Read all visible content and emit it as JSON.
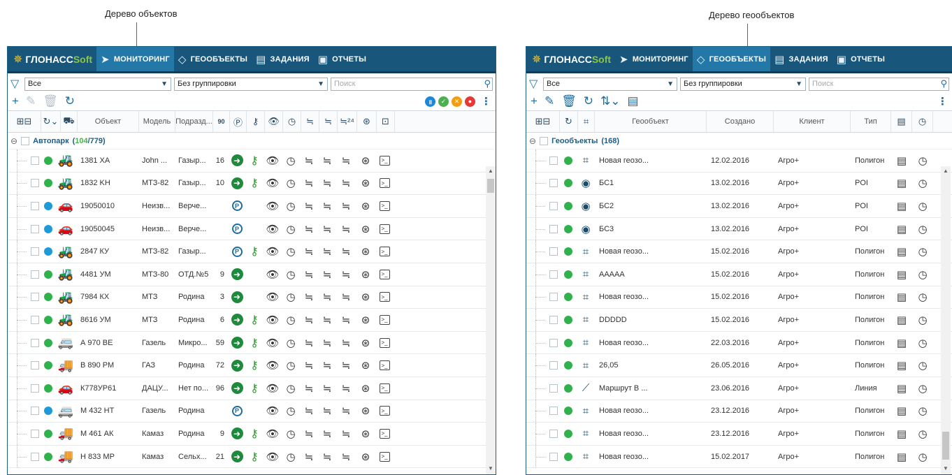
{
  "callouts": {
    "left": "Дерево объектов",
    "right": "Дерево геообъектов"
  },
  "brand": {
    "part1": "ГЛОНАСС",
    "part2": "Soft"
  },
  "nav": [
    {
      "label": "МОНИТОРИНГ",
      "icon": "navigation-arrow-icon"
    },
    {
      "label": "ГЕООБЪЕКТЫ",
      "icon": "geoobject-diamond-icon"
    },
    {
      "label": "ЗАДАНИЯ",
      "icon": "tasks-icon"
    },
    {
      "label": "ОТЧЕТЫ",
      "icon": "reports-icon"
    }
  ],
  "left_panel": {
    "filter_value": "Все",
    "grouping_value": "Без группировки",
    "search_placeholder": "Поиск",
    "columns": [
      "Объект",
      "Модель",
      "Подразд..."
    ],
    "speed_header": "90",
    "group": {
      "name": "Автопарк",
      "online": "104",
      "total": "779"
    },
    "rows": [
      {
        "name": "1381 XA",
        "model": "John ...",
        "dept": "Газыр...",
        "speed": "16",
        "status": "green",
        "vehicle": "tractor",
        "go": true,
        "park": false,
        "key": true
      },
      {
        "name": "1832 KH",
        "model": "МТЗ-82",
        "dept": "Газыр...",
        "speed": "10",
        "status": "green",
        "vehicle": "loader",
        "go": true,
        "park": false,
        "key": true
      },
      {
        "name": "19050010",
        "model": "Неизв...",
        "dept": "Верче...",
        "speed": "",
        "status": "blue",
        "vehicle": "car",
        "go": false,
        "park": true,
        "key": false
      },
      {
        "name": "19050045",
        "model": "Неизв...",
        "dept": "Верче...",
        "speed": "",
        "status": "blue",
        "vehicle": "car",
        "go": false,
        "park": true,
        "key": false
      },
      {
        "name": "2847 КУ",
        "model": "МТЗ-82",
        "dept": "Газыр...",
        "speed": "",
        "status": "blue",
        "vehicle": "loader",
        "go": false,
        "park": true,
        "key": true
      },
      {
        "name": "4481 УМ",
        "model": "МТЗ-80",
        "dept": "ОТД.№5",
        "speed": "9",
        "status": "green",
        "vehicle": "loader",
        "go": true,
        "park": false,
        "key": false
      },
      {
        "name": "7984 КХ",
        "model": "МТЗ",
        "dept": "Родина",
        "speed": "3",
        "status": "green",
        "vehicle": "loader",
        "go": true,
        "park": false,
        "key": false
      },
      {
        "name": "8616 УМ",
        "model": "МТЗ",
        "dept": "Родина",
        "speed": "6",
        "status": "green",
        "vehicle": "loader",
        "go": true,
        "park": false,
        "key": true
      },
      {
        "name": "А 970 ВЕ",
        "model": "Газель",
        "dept": "Микро...",
        "speed": "59",
        "status": "green",
        "vehicle": "van",
        "go": true,
        "park": false,
        "key": true
      },
      {
        "name": "В 890 РМ",
        "model": "ГАЗ",
        "dept": "Родина",
        "speed": "72",
        "status": "green",
        "vehicle": "truck",
        "go": true,
        "park": false,
        "key": true
      },
      {
        "name": "К778УР61",
        "model": "ДАЦУ...",
        "dept": "Нет по...",
        "speed": "96",
        "status": "green",
        "vehicle": "car",
        "go": true,
        "park": false,
        "key": true
      },
      {
        "name": "М 432 НТ",
        "model": "Газель",
        "dept": "Родина",
        "speed": "",
        "status": "blue",
        "vehicle": "van",
        "go": false,
        "park": true,
        "key": false
      },
      {
        "name": "М 461 АК",
        "model": "Камаз",
        "dept": "Родина",
        "speed": "9",
        "status": "green",
        "vehicle": "truck",
        "go": true,
        "park": false,
        "key": true
      },
      {
        "name": "Н 833 МР",
        "model": "Камаз",
        "dept": "Сельх...",
        "speed": "21",
        "status": "green",
        "vehicle": "truck",
        "go": true,
        "park": false,
        "key": true
      }
    ]
  },
  "right_panel": {
    "filter_value": "Все",
    "grouping_value": "Без группировки",
    "search_placeholder": "Поиск",
    "columns": [
      "Геообъект",
      "Создано",
      "Клиент",
      "Тип"
    ],
    "group": {
      "name": "Геообъекты",
      "count": "168"
    },
    "rows": [
      {
        "name": "Новая геозо...",
        "created": "12.02.2016",
        "client": "Агро+",
        "type": "Полигон",
        "kind": "polygon"
      },
      {
        "name": "БС1",
        "created": "13.02.2016",
        "client": "Агро+",
        "type": "POI",
        "kind": "poi"
      },
      {
        "name": "БС2",
        "created": "13.02.2016",
        "client": "Агро+",
        "type": "POI",
        "kind": "poi"
      },
      {
        "name": "БС3",
        "created": "13.02.2016",
        "client": "Агро+",
        "type": "POI",
        "kind": "poi"
      },
      {
        "name": "Новая геозо...",
        "created": "15.02.2016",
        "client": "Агро+",
        "type": "Полигон",
        "kind": "polygon"
      },
      {
        "name": "ААААА",
        "created": "15.02.2016",
        "client": "Агро+",
        "type": "Полигон",
        "kind": "polygon"
      },
      {
        "name": "Новая геозо...",
        "created": "15.02.2016",
        "client": "Агро+",
        "type": "Полигон",
        "kind": "polygon"
      },
      {
        "name": "DDDDD",
        "created": "15.02.2016",
        "client": "Агро+",
        "type": "Полигон",
        "kind": "polygon"
      },
      {
        "name": "Новая геозо...",
        "created": "22.03.2016",
        "client": "Агро+",
        "type": "Полигон",
        "kind": "polygon"
      },
      {
        "name": "26,05",
        "created": "26.05.2016",
        "client": "Агро+",
        "type": "Полигон",
        "kind": "polygon"
      },
      {
        "name": "Маршрут В ...",
        "created": "23.06.2016",
        "client": "Агро+",
        "type": "Линия",
        "kind": "line"
      },
      {
        "name": "Новая геозо...",
        "created": "23.12.2016",
        "client": "Агро+",
        "type": "Полигон",
        "kind": "polygon"
      },
      {
        "name": "Новая геозо...",
        "created": "23.12.2016",
        "client": "Агро+",
        "type": "Полигон",
        "kind": "polygon"
      },
      {
        "name": "Новая геозо...",
        "created": "15.02.2017",
        "client": "Агро+",
        "type": "Полигон",
        "kind": "polygon"
      }
    ]
  },
  "colors": {
    "nav_bg": "#18577b",
    "nav_active": "#2378a8",
    "status_green": "#2fb24c",
    "status_blue": "#1e9bd7",
    "go_green": "#1d8a3c",
    "accent_blue": "#1d6da0"
  }
}
